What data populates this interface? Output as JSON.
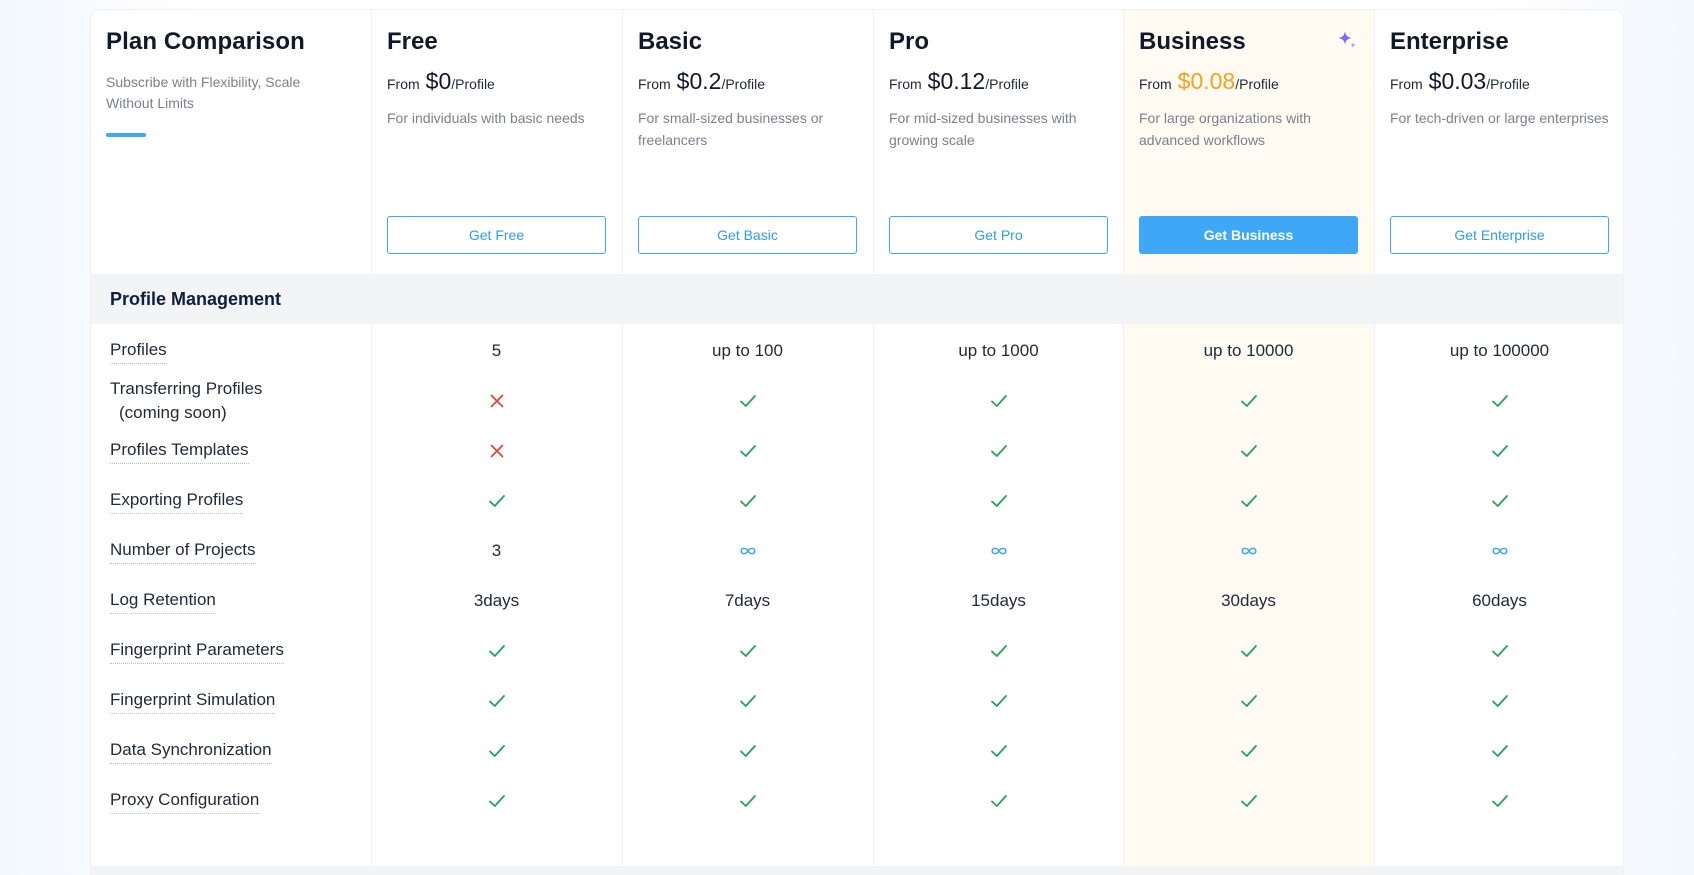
{
  "header": {
    "title": "Plan Comparison",
    "subtitle": "Subscribe with Flexibility, Scale Without Limits"
  },
  "plans": [
    {
      "name": "Free",
      "from": "From",
      "price": "$0",
      "unit": "/Profile",
      "desc": "For individuals with basic needs",
      "button": "Get Free",
      "highlight": false
    },
    {
      "name": "Basic",
      "from": "From",
      "price": "$0.2",
      "unit": "/Profile",
      "desc": "For small-sized businesses or freelancers",
      "button": "Get Basic",
      "highlight": false
    },
    {
      "name": "Pro",
      "from": "From",
      "price": "$0.12",
      "unit": "/Profile",
      "desc": "For mid-sized businesses with growing scale",
      "button": "Get Pro",
      "highlight": false
    },
    {
      "name": "Business",
      "from": "From",
      "price": "$0.08",
      "unit": "/Profile",
      "desc": "For large organizations with advanced workflows",
      "button": "Get Business",
      "highlight": true
    },
    {
      "name": "Enterprise",
      "from": "From",
      "price": "$0.03",
      "unit": "/Profile",
      "desc": "For tech-driven or large enterprises",
      "button": "Get Enterprise",
      "highlight": false
    }
  ],
  "section": {
    "title": "Profile Management"
  },
  "features": [
    {
      "name": "Profiles",
      "values": [
        "5",
        "up to 100",
        "up to 1000",
        "up to 10000",
        "up to 100000"
      ]
    },
    {
      "name": "Transferring Profiles",
      "name2": "(coming soon)",
      "values": [
        "cross-icon",
        "check-icon",
        "check-icon",
        "check-icon",
        "check-icon"
      ]
    },
    {
      "name": "Profiles Templates",
      "values": [
        "cross-icon",
        "check-icon",
        "check-icon",
        "check-icon",
        "check-icon"
      ]
    },
    {
      "name": "Exporting Profiles",
      "values": [
        "check-icon",
        "check-icon",
        "check-icon",
        "check-icon",
        "check-icon"
      ]
    },
    {
      "name": "Number of Projects",
      "values": [
        "3",
        "infinity-icon",
        "infinity-icon",
        "infinity-icon",
        "infinity-icon"
      ]
    },
    {
      "name": "Log Retention",
      "values": [
        "3days",
        "7days",
        "15days",
        "30days",
        "60days"
      ]
    },
    {
      "name": "Fingerprint Parameters",
      "values": [
        "check-icon",
        "check-icon",
        "check-icon",
        "check-icon",
        "check-icon"
      ]
    },
    {
      "name": "Fingerprint Simulation",
      "values": [
        "check-icon",
        "check-icon",
        "check-icon",
        "check-icon",
        "check-icon"
      ]
    },
    {
      "name": "Data Synchronization",
      "values": [
        "check-icon",
        "check-icon",
        "check-icon",
        "check-icon",
        "check-icon"
      ]
    },
    {
      "name": "Proxy Configuration",
      "values": [
        "check-icon",
        "check-icon",
        "check-icon",
        "check-icon",
        "check-icon"
      ]
    }
  ],
  "colors": {
    "accent": "#3ea7f6",
    "check": "#22a35a",
    "cross": "#e0442d",
    "highlight_price": "#f7a21b",
    "highlight_bg": "#fffbf3"
  }
}
